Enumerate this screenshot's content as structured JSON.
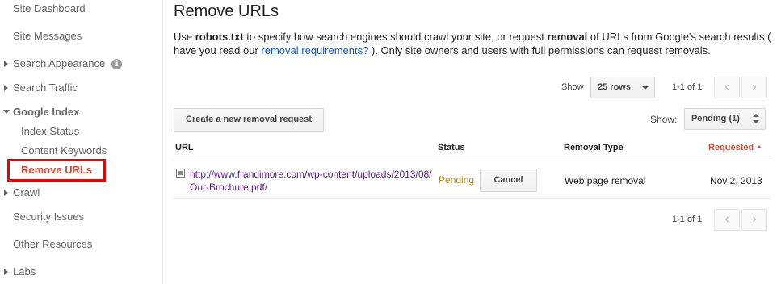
{
  "sidebar": {
    "items": [
      {
        "label": "Site Dashboard"
      },
      {
        "label": "Site Messages"
      },
      {
        "label": "Search Appearance"
      },
      {
        "label": "Search Traffic"
      },
      {
        "label": "Google Index"
      },
      {
        "label": "Index Status"
      },
      {
        "label": "Content Keywords"
      },
      {
        "label": "Remove URLs"
      },
      {
        "label": "Crawl"
      },
      {
        "label": "Security Issues"
      },
      {
        "label": "Other Resources"
      },
      {
        "label": "Labs"
      }
    ],
    "info_icon_glyph": "i"
  },
  "main": {
    "title": "Remove URLs",
    "desc_part1": "Use ",
    "desc_bold1": "robots.txt",
    "desc_part2": " to specify how search engines should crawl your site, or request ",
    "desc_bold2": "removal",
    "desc_part3": " of URLs from Google's search results ( have you read our ",
    "desc_link": "removal requirements?",
    "desc_part4": " ). Only site owners and users with full permissions can request removals."
  },
  "toolbar": {
    "show_label": "Show",
    "rows_select": "25 rows",
    "pager_text": "1-1 of 1",
    "prev_glyph": "‹",
    "next_glyph": "›",
    "create_button": "Create a new removal request",
    "filter_label": "Show:",
    "filter_select": "Pending (1)"
  },
  "table": {
    "headers": {
      "url": "URL",
      "status": "Status",
      "type": "Removal Type",
      "requested": "Requested"
    },
    "rows": [
      {
        "url": "http://www.frandimore.com/wp-content/uploads/2013/08/Our-Brochure.pdf/",
        "status": "Pending",
        "action": "Cancel",
        "type": "Web page removal",
        "requested": "Nov 2, 2013"
      }
    ]
  },
  "footer_pager": {
    "text": "1-1 of 1"
  },
  "colors": {
    "accent": "#dd4b39",
    "link": "#1155cc",
    "visited": "#551a8b",
    "pending": "#b99000",
    "highlight": "#ee0000"
  }
}
